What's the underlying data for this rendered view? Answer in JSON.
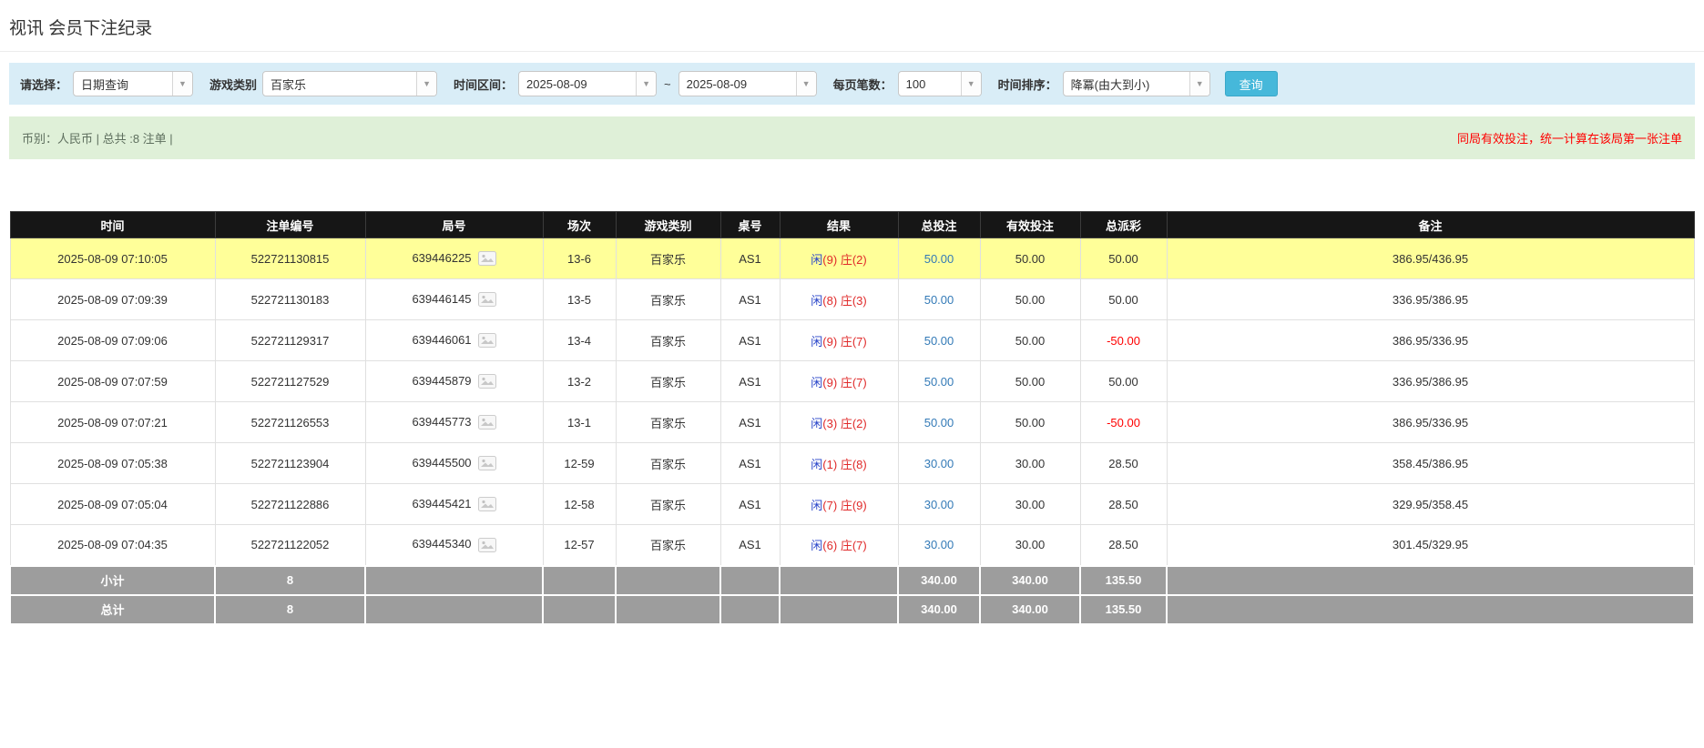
{
  "page": {
    "title": "视讯 会员下注纪录"
  },
  "colors": {
    "filter_bar_bg": "#d9edf7",
    "summary_bar_bg": "#dff0d8",
    "header_bg": "#161616",
    "highlight_row_bg": "#ffff99",
    "footer_row_bg": "#9d9d9d",
    "accent_button": "#46b8da",
    "link_blue": "#337ab7",
    "negative_red": "#ff0000",
    "result_player_blue": "#2945c9",
    "result_banker_red": "#e02a2a"
  },
  "filters": {
    "select_label": "请选择：",
    "select_value": "日期查询",
    "game_type_label": "游戏类别",
    "game_type_value": "百家乐",
    "time_range_label": "时间区间：",
    "date_from": "2025-08-09",
    "date_separator": "~",
    "date_to": "2025-08-09",
    "page_size_label": "每页笔数：",
    "page_size_value": "100",
    "sort_label": "时间排序：",
    "sort_value": "降冪(由大到小)",
    "search_button": "查询"
  },
  "summary": {
    "left": "币别：人民币 | 总共 :8 注单 |",
    "right": "同局有效投注，统一计算在该局第一张注单"
  },
  "table": {
    "headers": [
      "时间",
      "注单编号",
      "局号",
      "场次",
      "游戏类别",
      "桌号",
      "结果",
      "总投注",
      "有效投注",
      "总派彩",
      "备注"
    ],
    "rows": [
      {
        "highlighted": true,
        "time": "2025-08-09 07:10:05",
        "bet_id": "522721130815",
        "round_id": "639446225",
        "session": "13-6",
        "game": "百家乐",
        "table_no": "AS1",
        "result": {
          "player": "闲",
          "player_score": "(9)",
          "banker": "庄",
          "banker_score": "(2)"
        },
        "total_bet": "50.00",
        "valid_bet": "50.00",
        "payout": "50.00",
        "note": "386.95/436.95"
      },
      {
        "highlighted": false,
        "time": "2025-08-09 07:09:39",
        "bet_id": "522721130183",
        "round_id": "639446145",
        "session": "13-5",
        "game": "百家乐",
        "table_no": "AS1",
        "result": {
          "player": "闲",
          "player_score": "(8)",
          "banker": "庄",
          "banker_score": "(3)"
        },
        "total_bet": "50.00",
        "valid_bet": "50.00",
        "payout": "50.00",
        "note": "336.95/386.95"
      },
      {
        "highlighted": false,
        "time": "2025-08-09 07:09:06",
        "bet_id": "522721129317",
        "round_id": "639446061",
        "session": "13-4",
        "game": "百家乐",
        "table_no": "AS1",
        "result": {
          "player": "闲",
          "player_score": "(9)",
          "banker": "庄",
          "banker_score": "(7)"
        },
        "total_bet": "50.00",
        "valid_bet": "50.00",
        "payout": "-50.00",
        "note": "386.95/336.95"
      },
      {
        "highlighted": false,
        "time": "2025-08-09 07:07:59",
        "bet_id": "522721127529",
        "round_id": "639445879",
        "session": "13-2",
        "game": "百家乐",
        "table_no": "AS1",
        "result": {
          "player": "闲",
          "player_score": "(9)",
          "banker": "庄",
          "banker_score": "(7)"
        },
        "total_bet": "50.00",
        "valid_bet": "50.00",
        "payout": "50.00",
        "note": "336.95/386.95"
      },
      {
        "highlighted": false,
        "time": "2025-08-09 07:07:21",
        "bet_id": "522721126553",
        "round_id": "639445773",
        "session": "13-1",
        "game": "百家乐",
        "table_no": "AS1",
        "result": {
          "player": "闲",
          "player_score": "(3)",
          "banker": "庄",
          "banker_score": "(2)"
        },
        "total_bet": "50.00",
        "valid_bet": "50.00",
        "payout": "-50.00",
        "note": "386.95/336.95"
      },
      {
        "highlighted": false,
        "time": "2025-08-09 07:05:38",
        "bet_id": "522721123904",
        "round_id": "639445500",
        "session": "12-59",
        "game": "百家乐",
        "table_no": "AS1",
        "result": {
          "player": "闲",
          "player_score": "(1)",
          "banker": "庄",
          "banker_score": "(8)"
        },
        "total_bet": "30.00",
        "valid_bet": "30.00",
        "payout": "28.50",
        "note": "358.45/386.95"
      },
      {
        "highlighted": false,
        "time": "2025-08-09 07:05:04",
        "bet_id": "522721122886",
        "round_id": "639445421",
        "session": "12-58",
        "game": "百家乐",
        "table_no": "AS1",
        "result": {
          "player": "闲",
          "player_score": "(7)",
          "banker": "庄",
          "banker_score": "(9)"
        },
        "total_bet": "30.00",
        "valid_bet": "30.00",
        "payout": "28.50",
        "note": "329.95/358.45"
      },
      {
        "highlighted": false,
        "time": "2025-08-09 07:04:35",
        "bet_id": "522721122052",
        "round_id": "639445340",
        "session": "12-57",
        "game": "百家乐",
        "table_no": "AS1",
        "result": {
          "player": "闲",
          "player_score": "(6)",
          "banker": "庄",
          "banker_score": "(7)"
        },
        "total_bet": "30.00",
        "valid_bet": "30.00",
        "payout": "28.50",
        "note": "301.45/329.95"
      }
    ],
    "footer": [
      {
        "label": "小计",
        "count": "8",
        "total_bet": "340.00",
        "valid_bet": "340.00",
        "payout": "135.50",
        "note": ""
      },
      {
        "label": "总计",
        "count": "8",
        "total_bet": "340.00",
        "valid_bet": "340.00",
        "payout": "135.50",
        "note": ""
      }
    ]
  }
}
